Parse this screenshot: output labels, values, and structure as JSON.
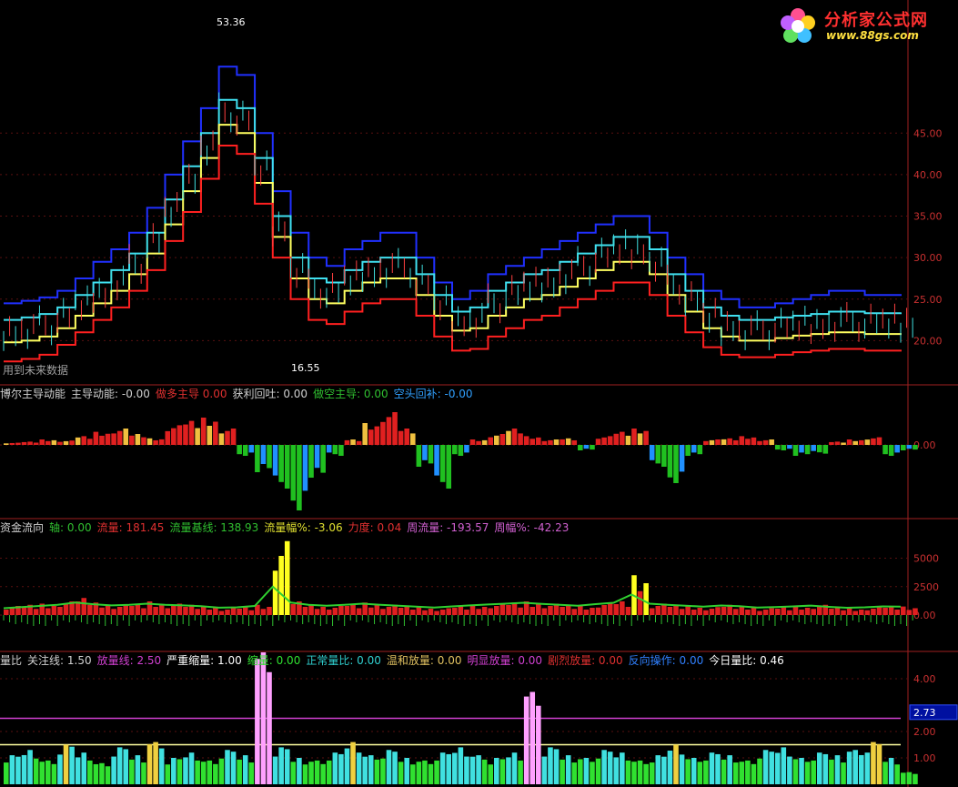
{
  "logo": {
    "title": "分析家公式网",
    "url": "www.88gs.com"
  },
  "main_panel": {
    "note": "用到未来数据",
    "high_label": "53.36",
    "low_label": "16.55",
    "y_ticks": [
      "45.00",
      "40.00",
      "35.00",
      "30.00",
      "25.00",
      "20.00"
    ]
  },
  "panel2": {
    "items": [
      {
        "label": "博尔主导动能",
        "color": "#d0d0d0"
      },
      {
        "label": "主导动能: -0.00",
        "color": "#d0d0d0"
      },
      {
        "label": "做多主导 0.00",
        "color": "#e03030"
      },
      {
        "label": "获利回吐: 0.00",
        "color": "#d0d0d0"
      },
      {
        "label": "做空主导: 0.00",
        "color": "#30c030"
      },
      {
        "label": "空头回补: -0.00",
        "color": "#30a0ff"
      }
    ],
    "y_ticks": [
      "0.00"
    ]
  },
  "panel3": {
    "items": [
      {
        "label": "资金流向",
        "color": "#d0d0d0"
      },
      {
        "label": "轴: 0.00",
        "color": "#30c030"
      },
      {
        "label": "流量: 181.45",
        "color": "#e03030"
      },
      {
        "label": "流量基线: 138.93",
        "color": "#30c030"
      },
      {
        "label": "流量幅%: -3.06",
        "color": "#e0e030"
      },
      {
        "label": "力度: 0.04",
        "color": "#e03030"
      },
      {
        "label": "周流量: -193.57",
        "color": "#d060d0"
      },
      {
        "label": "周幅%: -42.23",
        "color": "#d060d0"
      }
    ],
    "y_ticks": [
      "5000",
      "2500",
      "0.00"
    ]
  },
  "panel4": {
    "items": [
      {
        "label": "量比",
        "color": "#d0d0d0"
      },
      {
        "label": "关注线: 1.50",
        "color": "#d0d0d0"
      },
      {
        "label": "放量线: 2.50",
        "color": "#d040d0"
      },
      {
        "label": "严重缩量: 1.00",
        "color": "#ffffff"
      },
      {
        "label": "缩量: 0.00",
        "color": "#30e030"
      },
      {
        "label": "正常量比: 0.00",
        "color": "#30d0d0"
      },
      {
        "label": "温和放量: 0.00",
        "color": "#e0c060"
      },
      {
        "label": "明显放量: 0.00",
        "color": "#d040d0"
      },
      {
        "label": "剧烈放量: 0.00",
        "color": "#e03030"
      },
      {
        "label": "反向操作: 0.00",
        "color": "#3080ff"
      },
      {
        "label": "今日量比: 0.46",
        "color": "#ffffff"
      }
    ],
    "y_ticks": [
      "4.00",
      "2.00",
      "1.00"
    ],
    "current_value": "2.73"
  },
  "chart_data": [
    {
      "type": "line",
      "name": "main-price-channel",
      "ylim": [
        15,
        55
      ],
      "series": [
        {
          "name": "",
          "color": "#2030ff",
          "values": [
            24.5,
            24.8,
            25.2,
            26,
            27.5,
            29.5,
            31,
            33,
            36,
            40,
            44,
            48,
            53,
            52,
            45,
            38,
            33,
            30,
            29,
            31,
            32,
            33,
            33,
            30,
            27,
            25,
            26,
            28,
            29,
            30,
            31,
            32,
            33,
            34,
            35,
            35,
            33,
            30,
            28,
            26,
            25,
            24,
            24,
            24.5,
            25,
            25.5,
            26,
            26,
            25.5,
            25.5,
            25.6
          ]
        },
        {
          "name": "",
          "color": "#40e0f0",
          "values": [
            22.5,
            22.8,
            23.2,
            24,
            25.5,
            27,
            28.5,
            30.5,
            33,
            37,
            41,
            45,
            49,
            48,
            42,
            35,
            30,
            27.5,
            27,
            28.5,
            29.5,
            30,
            30,
            28,
            25.5,
            23.5,
            24,
            26,
            27,
            28,
            28.5,
            29.5,
            30.5,
            31.5,
            32.5,
            32.5,
            31,
            28,
            26,
            24,
            23,
            22.5,
            22.5,
            22.8,
            23,
            23.2,
            23.5,
            23.5,
            23.3,
            23.3,
            23.4
          ]
        },
        {
          "name": "",
          "color": "#ffff60",
          "values": [
            19.8,
            20,
            20.5,
            21.5,
            23,
            24.5,
            26,
            28,
            30.5,
            34,
            38,
            42,
            46,
            45,
            39,
            32.5,
            27.5,
            25,
            24.5,
            26,
            27,
            27.5,
            27.5,
            25.5,
            23,
            21.2,
            21.5,
            23,
            24,
            25,
            25.5,
            26.5,
            27.5,
            28.5,
            29.5,
            29.5,
            28,
            25.5,
            23.5,
            21.5,
            20.5,
            20,
            20,
            20.3,
            20.6,
            20.8,
            21,
            21,
            20.8,
            20.8,
            20.9
          ]
        },
        {
          "name": "",
          "color": "#ff2020",
          "values": [
            17.5,
            17.8,
            18.3,
            19.5,
            21,
            22.5,
            24,
            26,
            28.5,
            32,
            35.5,
            39.5,
            43.5,
            42.5,
            36.5,
            30,
            25,
            22.5,
            22,
            23.5,
            24.5,
            25,
            25,
            23,
            20.5,
            18.8,
            19,
            20.5,
            21.5,
            22.5,
            23,
            24,
            25,
            26,
            27,
            27,
            25.5,
            23,
            21,
            19.2,
            18.3,
            18,
            18,
            18.3,
            18.6,
            18.8,
            19,
            19,
            18.8,
            18.8,
            18.9
          ]
        }
      ]
    },
    {
      "type": "bar",
      "name": "dominant-momentum",
      "values": [
        0.2,
        0.3,
        0.5,
        0.4,
        0.8,
        1.2,
        1.5,
        1,
        0.6,
        1.8,
        2.2,
        2.5,
        1.5,
        -1,
        -2.5,
        -4,
        -6,
        -3,
        -1,
        0.5,
        2,
        3,
        1.5,
        -2,
        -4,
        -1,
        0.5,
        1,
        1.5,
        0.8,
        0.5,
        0.6,
        -0.5,
        0.8,
        1.2,
        1.5,
        -2,
        -3.5,
        -1,
        0.5,
        0.6,
        0.8,
        0.5,
        -0.5,
        -1,
        -0.8,
        0.3,
        0.5,
        0.7,
        -1,
        -0.5
      ]
    },
    {
      "type": "bar",
      "name": "fund-flow",
      "values": [
        800,
        900,
        1000,
        1200,
        1500,
        1100,
        900,
        1000,
        1200,
        1000,
        900,
        800,
        600,
        700,
        900,
        6500,
        1200,
        900,
        800,
        1000,
        1100,
        900,
        800,
        700,
        600,
        800,
        900,
        1000,
        1100,
        1200,
        1000,
        900,
        800,
        1100,
        1200,
        3500,
        1000,
        900,
        800,
        700,
        900,
        800,
        600,
        700,
        800,
        900,
        700,
        600,
        700,
        800,
        750
      ],
      "baseline": [
        600,
        700,
        800,
        900,
        1100,
        950,
        850,
        900,
        1000,
        900,
        850,
        780,
        650,
        680,
        800,
        2500,
        1100,
        900,
        820,
        900,
        1000,
        900,
        820,
        740,
        660,
        760,
        850,
        930,
        1000,
        1080,
        980,
        900,
        820,
        960,
        1080,
        1800,
        1000,
        900,
        820,
        740,
        840,
        780,
        660,
        700,
        760,
        830,
        720,
        640,
        680,
        760,
        740
      ]
    },
    {
      "type": "bar",
      "name": "volume-ratio",
      "ylim": [
        0,
        5
      ],
      "values": [
        1.1,
        1.3,
        0.9,
        1.5,
        1.2,
        0.8,
        1.4,
        1.1,
        1.6,
        1.0,
        1.2,
        0.9,
        1.3,
        1.1,
        5.0,
        1.4,
        1.0,
        0.9,
        1.2,
        1.6,
        1.1,
        1.3,
        1.0,
        0.9,
        1.2,
        1.4,
        1.1,
        1.0,
        1.2,
        3.5,
        1.4,
        1.1,
        1.0,
        1.3,
        1.2,
        0.9,
        1.1,
        1.5,
        1.0,
        1.2,
        1.1,
        0.9,
        1.3,
        1.4,
        1.0,
        1.2,
        1.1,
        1.3,
        1.6,
        1.0,
        0.46
      ],
      "ref_lines": [
        2.5,
        1.5
      ]
    }
  ]
}
